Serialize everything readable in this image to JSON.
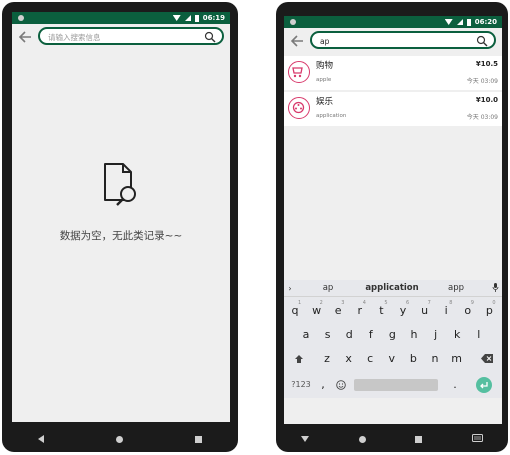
{
  "left_screen": {
    "status": {
      "time": "06:19"
    },
    "search": {
      "placeholder": "请输入搜索信息",
      "value": ""
    },
    "empty": {
      "message": "数据为空，无此类记录~~"
    }
  },
  "right_screen": {
    "status": {
      "time": "06:20"
    },
    "search": {
      "placeholder": "",
      "value": "ap"
    },
    "results": [
      {
        "title": "购物",
        "subtitle": "apple",
        "amount": "¥10.5",
        "time": "今天 03:09",
        "icon": "cart-icon",
        "icon_color": "#d8396b"
      },
      {
        "title": "娱乐",
        "subtitle": "application",
        "amount": "¥10.0",
        "time": "今天 03:09",
        "icon": "film-icon",
        "icon_color": "#d8396b"
      }
    ],
    "keyboard": {
      "suggestions": [
        "ap",
        "application",
        "app"
      ],
      "row1": [
        "q",
        "w",
        "e",
        "r",
        "t",
        "y",
        "u",
        "i",
        "o",
        "p"
      ],
      "row1_hints": [
        "1",
        "2",
        "3",
        "4",
        "5",
        "6",
        "7",
        "8",
        "9",
        "0"
      ],
      "row2": [
        "a",
        "s",
        "d",
        "f",
        "g",
        "h",
        "j",
        "k",
        "l"
      ],
      "row3": [
        "z",
        "x",
        "c",
        "v",
        "b",
        "n",
        "m"
      ],
      "sym_label": "?123",
      "comma": ",",
      "period": "."
    }
  },
  "colors": {
    "accent": "#0b5f3e",
    "icon_pink": "#d8396b",
    "enter": "#55bfa0"
  }
}
